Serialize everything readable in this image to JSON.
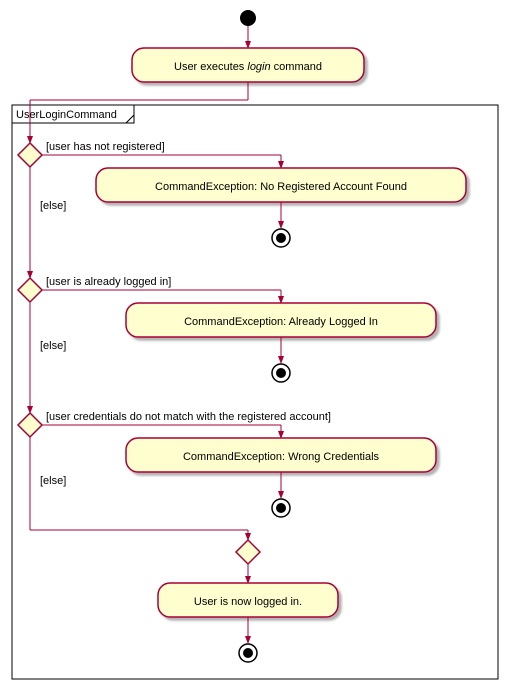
{
  "start_label": "User executes login command",
  "partition_title": "UserLoginCommand",
  "d1": {
    "cond": "[user has not registered]",
    "else": "[else]",
    "action": "CommandException: No Registered Account Found"
  },
  "d2": {
    "cond": "[user is already logged in]",
    "else": "[else]",
    "action": "CommandException: Already Logged In"
  },
  "d3": {
    "cond": "[user credentials do not match with the registered account]",
    "else": "[else]",
    "action": "CommandException: Wrong Credentials"
  },
  "final": "User is now logged in.",
  "chart_data": {
    "type": "activity_diagram",
    "start": "User executes login command",
    "partition": "UserLoginCommand",
    "decisions": [
      {
        "condition": "user has not registered",
        "then": "CommandException: No Registered Account Found",
        "then_terminal": true
      },
      {
        "condition": "user is already logged in",
        "then": "CommandException: Already Logged In",
        "then_terminal": true
      },
      {
        "condition": "user credentials do not match with the registered account",
        "then": "CommandException: Wrong Credentials",
        "then_terminal": true
      }
    ],
    "final_action": "User is now logged in.",
    "final_terminal": true
  }
}
